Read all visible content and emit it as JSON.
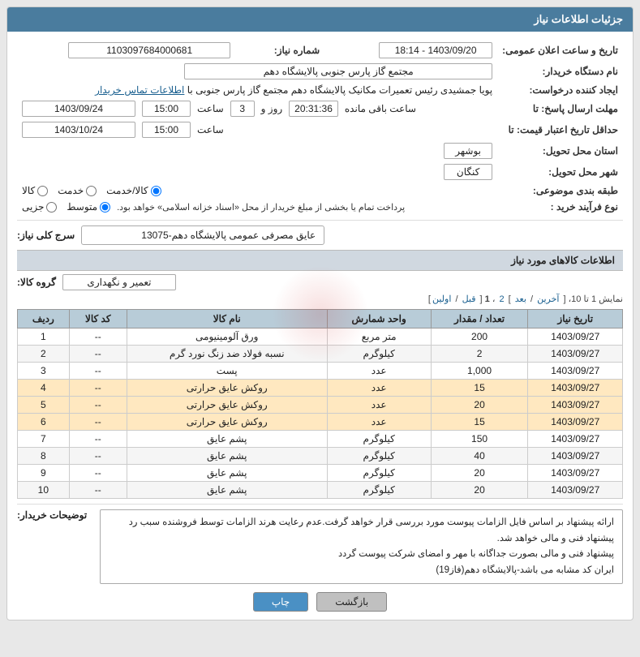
{
  "header": {
    "title": "جزئیات اطلاعات نیاز"
  },
  "fields": {
    "shomareNiaz_label": "شماره نیاز:",
    "shomareNiaz_value": "1103097684000681",
    "namedastgah_label": "نام دستگاه خریدار:",
    "namedastgah_value": "مجتمع گاز پارس جنوبی  پالایشگاه دهم",
    "ijadKonande_label": "ایجاد کننده درخواست:",
    "ijadKonande_value": "پویا جمشیدی رئیس تعمیرات مکانیک پالایشگاه دهم  مجتمع گاز پارس جنوبی  با",
    "ijadKonande_link": "اطلاعات تماس خریدار",
    "tarikh_label": "تاریخ و ساعت اعلان عمومی:",
    "tarikh_value": "1403/09/20 - 18:14",
    "mohlat_label": "مهلت ارسال پاسخ: تا",
    "mohlat_date": "1403/09/24",
    "mohlat_saат": "15:00",
    "mohlat_roz": "3",
    "mohlat_mande": "20:31:36",
    "hadaqal_label": "حداقل تاریخ اعتبار قیمت: تا",
    "hadaqal_date": "1403/10/24",
    "hadaqal_saат": "15:00",
    "ostan_label": "استان محل تحویل:",
    "ostan_value": "بوشهر",
    "shahr_label": "شهر محل تحویل:",
    "shahr_value": "کنگان",
    "tabaqe_label": "طبقه بندی موضوعی:",
    "tabaqe_options": [
      "کالا",
      "خدمت",
      "کالا/خدمت"
    ],
    "tabaqe_selected": "کالا/خدمت",
    "noeFarayand_label": "نوع فرآیند خرید :",
    "noeFarayand_options": [
      "جزیی",
      "متوسط"
    ],
    "noeFarayand_selected": "متوسط",
    "noeFarayand_note": "پرداخت تمام یا بخشی از مبلغ خریدار از محل «اسناد خزانه اسلامی» خواهد بود.",
    "sarjKoli_label": "سرج کلی نیاز:",
    "sarjKoli_value": "عایق مصرفی عمومی پالایشگاه دهم-13075",
    "kalaSection": {
      "title": "اطلاعات کالاهای مورد نیاز",
      "group_label": "گروه کالا:",
      "group_value": "تعمیر و نگهداری",
      "pagination": "نمایش 1 تا 10، [ آخرین / بعد ] 2، 1 [ قبل / اولین]",
      "columns": [
        "ردیف",
        "کد کالا",
        "نام کالا",
        "واحد شمارش",
        "تعداد / مقدار",
        "تاریخ نیاز"
      ],
      "rows": [
        {
          "radif": "1",
          "kod": "--",
          "name": "ورق آلومینیومی",
          "vahed": "متر مربع",
          "tedad": "200",
          "tarikh": "1403/09/27"
        },
        {
          "radif": "2",
          "kod": "--",
          "name": "نسبه فولاد ضد زنگ نورد گرم",
          "vahed": "کیلوگرم",
          "tedad": "2",
          "tarikh": "1403/09/27"
        },
        {
          "radif": "3",
          "kod": "--",
          "name": "پست",
          "vahed": "عدد",
          "tedad": "1,000",
          "tarikh": "1403/09/27"
        },
        {
          "radif": "4",
          "kod": "--",
          "name": "روکش عایق حرارتی",
          "vahed": "عدد",
          "tedad": "15",
          "tarikh": "1403/09/27"
        },
        {
          "radif": "5",
          "kod": "--",
          "name": "روکش عایق حرارتی",
          "vahed": "عدد",
          "tedad": "20",
          "tarikh": "1403/09/27"
        },
        {
          "radif": "6",
          "kod": "--",
          "name": "روکش عایق حرارتی",
          "vahed": "عدد",
          "tedad": "15",
          "tarikh": "1403/09/27"
        },
        {
          "radif": "7",
          "kod": "--",
          "name": "پشم عایق",
          "vahed": "کیلوگرم",
          "tedad": "150",
          "tarikh": "1403/09/27"
        },
        {
          "radif": "8",
          "kod": "--",
          "name": "پشم عایق",
          "vahed": "کیلوگرم",
          "tedad": "40",
          "tarikh": "1403/09/27"
        },
        {
          "radif": "9",
          "kod": "--",
          "name": "پشم عایق",
          "vahed": "کیلوگرم",
          "tedad": "20",
          "tarikh": "1403/09/27"
        },
        {
          "radif": "10",
          "kod": "--",
          "name": "پشم عایق",
          "vahed": "کیلوگرم",
          "tedad": "20",
          "tarikh": "1403/09/27"
        }
      ]
    },
    "notes_label": "توضیحات خریدار:",
    "notes_line1": "ارائه پیشنهاد بر اساس فایل الزامات پیوست مورد بررسی قرار خواهد گرفت.عدم رعایت هرند الزامات توسط فروشنده سبب رد",
    "notes_line2": "پیشنهاد فنی و مالی خواهد شد.",
    "notes_line3": "پیشنهاد فنی و مالی بصورت جداگانه با مهر و امضای شرکت پیوست گردد",
    "notes_line4": "ایران کد مشابه می باشد-پالایشگاه دهم(فاز19)",
    "btn_chap": "چاپ",
    "btn_bazgasht": "بازگشت"
  }
}
